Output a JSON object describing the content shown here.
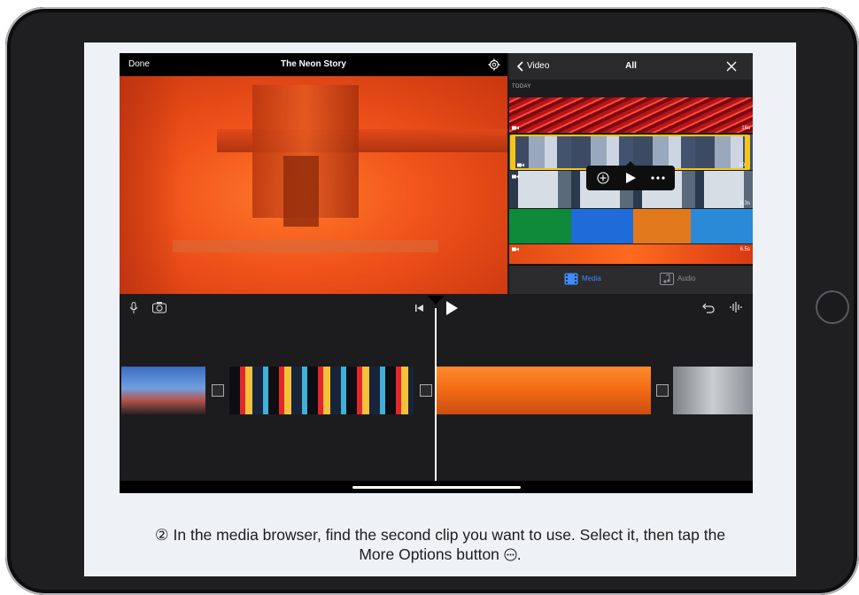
{
  "topbar": {
    "done_label": "Done",
    "project_title": "The Neon Story"
  },
  "browser": {
    "back_label": "Video",
    "filter_label": "All",
    "section_label": "TODAY",
    "clips": [
      {
        "duration": "16s"
      },
      {
        "duration": "10"
      },
      {
        "duration": "8.3s"
      },
      {
        "duration": ""
      },
      {
        "duration": "6.5s"
      },
      {
        "duration": ""
      }
    ],
    "tabs": {
      "media": "Media",
      "audio": "Audio"
    }
  },
  "caption": {
    "step_marker": "②",
    "line1": "In the media browser, find the second clip you want to use. Select it, then tap the",
    "line2": "More Options button",
    "line2_end": "."
  },
  "colors": {
    "accent": "#3b8cff",
    "selection": "#f5c518"
  },
  "icons": {
    "gear": "gear-icon",
    "back": "chevron-left-icon",
    "close": "close-icon",
    "add": "add-circle-icon",
    "play": "play-icon",
    "more": "more-options-icon",
    "mic": "microphone-icon",
    "camera": "camera-icon",
    "undo": "undo-icon",
    "waveform": "waveform-icon"
  }
}
